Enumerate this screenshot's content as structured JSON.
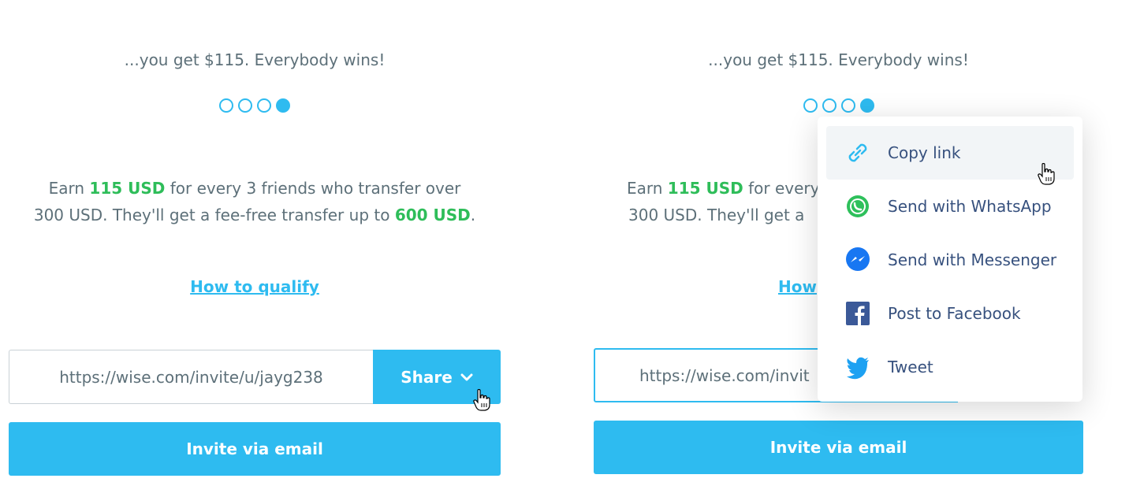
{
  "left_panel": {
    "tagline": "...you get $115. Everybody wins!",
    "desc": {
      "part1": "Earn ",
      "amount": "115 USD",
      "part2": " for every 3 friends who transfer over 300 USD. They'll get a fee-free transfer up to ",
      "limit": "600 USD",
      "part3": "."
    },
    "qualify_link": "How to qualify",
    "invite_url": "https://wise.com/invite/u/jayg238",
    "share_label": "Share",
    "email_button": "Invite via email"
  },
  "right_panel": {
    "tagline": "...you get $115. Everybody wins!",
    "desc": {
      "part1": "Earn ",
      "amount": "115 USD",
      "part2": " for every",
      "line2": "300 USD. They'll get a"
    },
    "qualify_link": "How",
    "invite_url": "https://wise.com/invit",
    "email_button": "Invite via email"
  },
  "pagination": {
    "total": 4,
    "active_index": 3
  },
  "share_menu": {
    "items": [
      {
        "label": "Copy link",
        "icon": "link-icon",
        "hovered": true
      },
      {
        "label": "Send with WhatsApp",
        "icon": "whatsapp-icon"
      },
      {
        "label": "Send with Messenger",
        "icon": "messenger-icon"
      },
      {
        "label": "Post to Facebook",
        "icon": "facebook-icon"
      },
      {
        "label": "Tweet",
        "icon": "twitter-icon"
      }
    ]
  },
  "colors": {
    "accent": "#2ebbf0",
    "highlight_green": "#2ebd59",
    "text": "#5d7079",
    "menu_text": "#37517e"
  }
}
